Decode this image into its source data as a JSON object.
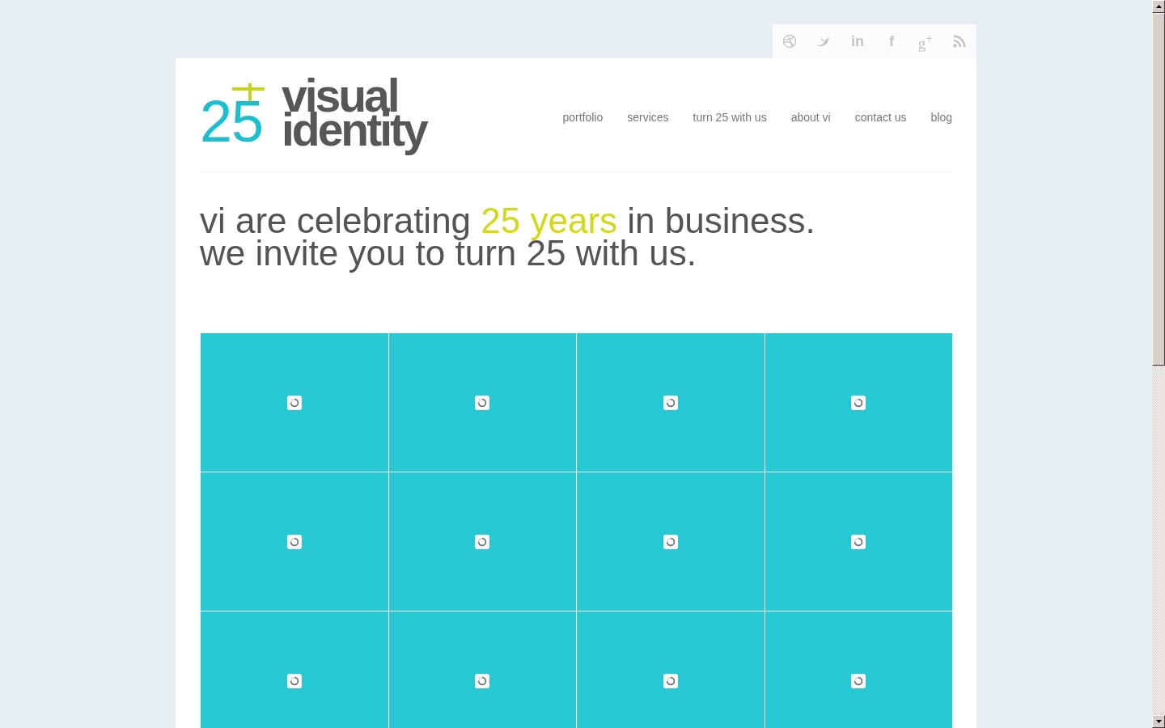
{
  "social_links": [
    {
      "kind": "ball"
    },
    {
      "kind": "bird"
    },
    {
      "kind": "letters",
      "text": "in"
    },
    {
      "kind": "letters",
      "text": "f"
    },
    {
      "kind": "serif-letters",
      "text": "g$^{+}$"
    },
    {
      "kind": "feed"
    }
  ],
  "logo": {
    "number": "25",
    "name_lines": [
      "visual",
      "identity"
    ]
  },
  "nav": [
    "portfolio",
    "services",
    "turn 25 with us",
    "about vi",
    "contact us",
    "blog"
  ],
  "headline": {
    "lines": [
      [
        {
          "text": "vi are celebrating ",
          "highlight": false
        },
        {
          "text": "25 years",
          "highlight": true
        },
        {
          "text": " in business.",
          "highlight": false
        }
      ],
      [
        {
          "text": "we invite you to turn 25 with us.",
          "highlight": false
        }
      ]
    ]
  },
  "gallery": {
    "tiles": [
      {
        "loading": true
      },
      {
        "loading": true
      },
      {
        "loading": true
      },
      {
        "loading": true
      },
      {
        "loading": true
      },
      {
        "loading": true
      },
      {
        "loading": true
      },
      {
        "loading": true
      },
      {
        "loading": true
      },
      {
        "loading": true
      },
      {
        "loading": true
      },
      {
        "loading": true
      }
    ]
  }
}
